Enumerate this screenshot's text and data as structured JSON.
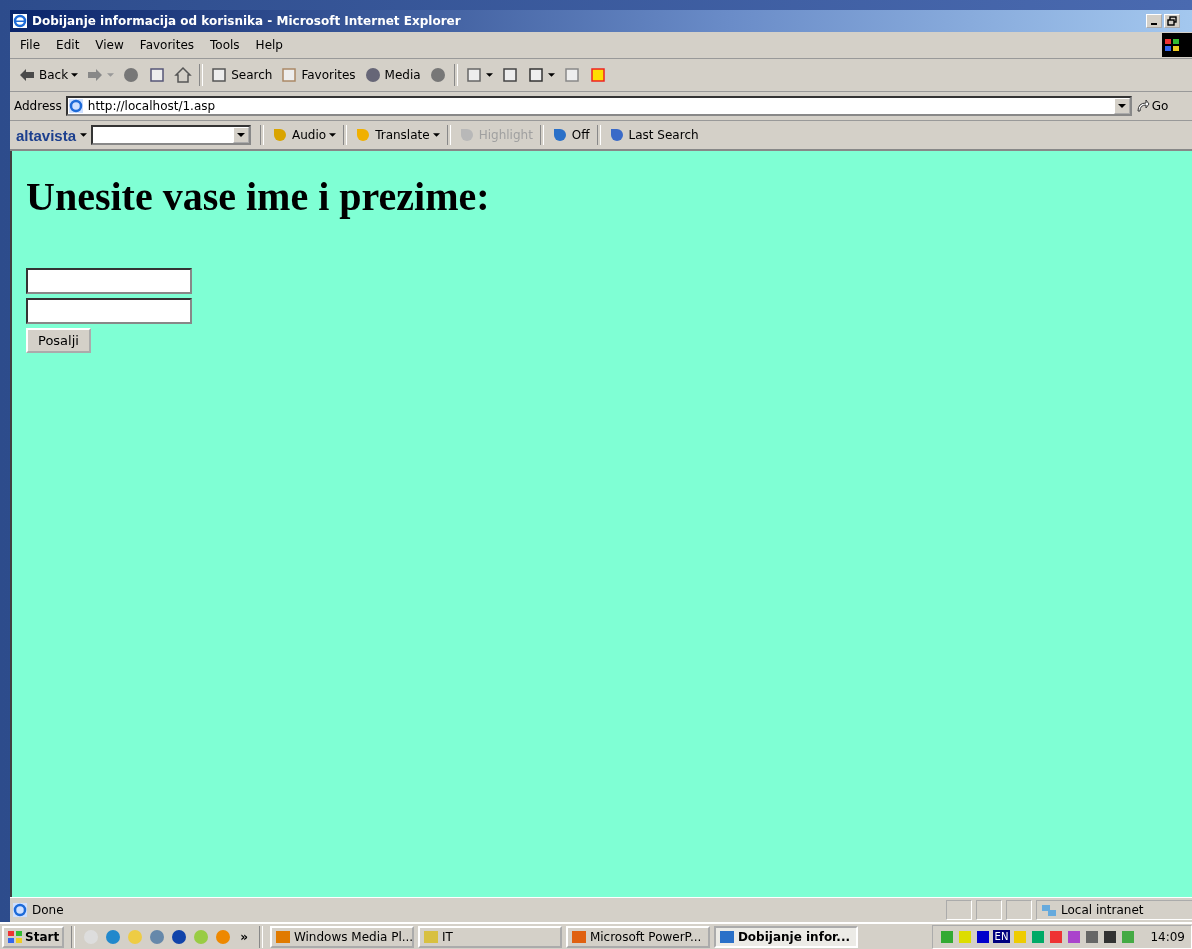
{
  "window": {
    "title": "Dobijanje informacija od korisnika - Microsoft Internet Explorer"
  },
  "menu": [
    "File",
    "Edit",
    "View",
    "Favorites",
    "Tools",
    "Help"
  ],
  "toolbar": [
    {
      "label": "Back",
      "dropdown": true
    },
    {
      "dropdown": true
    },
    {
      "dropdown": false
    },
    {
      "dropdown": false
    },
    {
      "dropdown": false
    },
    {
      "label": "Search",
      "dropdown": false
    },
    {
      "label": "Favorites",
      "dropdown": false
    },
    {
      "label": "Media",
      "dropdown": false
    },
    {
      "dropdown": false
    },
    {
      "dropdown": true
    },
    {
      "dropdown": false
    },
    {
      "dropdown": true
    },
    {
      "dropdown": false
    },
    {
      "dropdown": false
    }
  ],
  "address": {
    "label": "Address",
    "value": "http://localhost/1.asp",
    "go": "Go"
  },
  "altavista": {
    "logo": "altavista",
    "items": [
      {
        "label": "Audio",
        "dropdown": true,
        "disabled": false
      },
      {
        "label": "Translate",
        "dropdown": true,
        "disabled": false
      },
      {
        "label": "Highlight",
        "dropdown": false,
        "disabled": true
      },
      {
        "label": "Off",
        "dropdown": false,
        "disabled": false
      },
      {
        "label": "Last Search",
        "dropdown": false,
        "disabled": false
      }
    ]
  },
  "page": {
    "heading": "Unesite vase ime i prezime:",
    "submit": "Posalji"
  },
  "status_bar": {
    "text": "Done",
    "zone": "Local intranet"
  },
  "taskbar": {
    "start": "Start",
    "more": "»",
    "tasks": [
      {
        "label": "Windows Media Pl...",
        "selected": false
      },
      {
        "label": "IT",
        "selected": false
      },
      {
        "label": "Microsoft PowerP...",
        "selected": false
      },
      {
        "label": "Dobijanje infor...",
        "selected": true
      }
    ],
    "lang": "EN",
    "clock": "14:09"
  }
}
